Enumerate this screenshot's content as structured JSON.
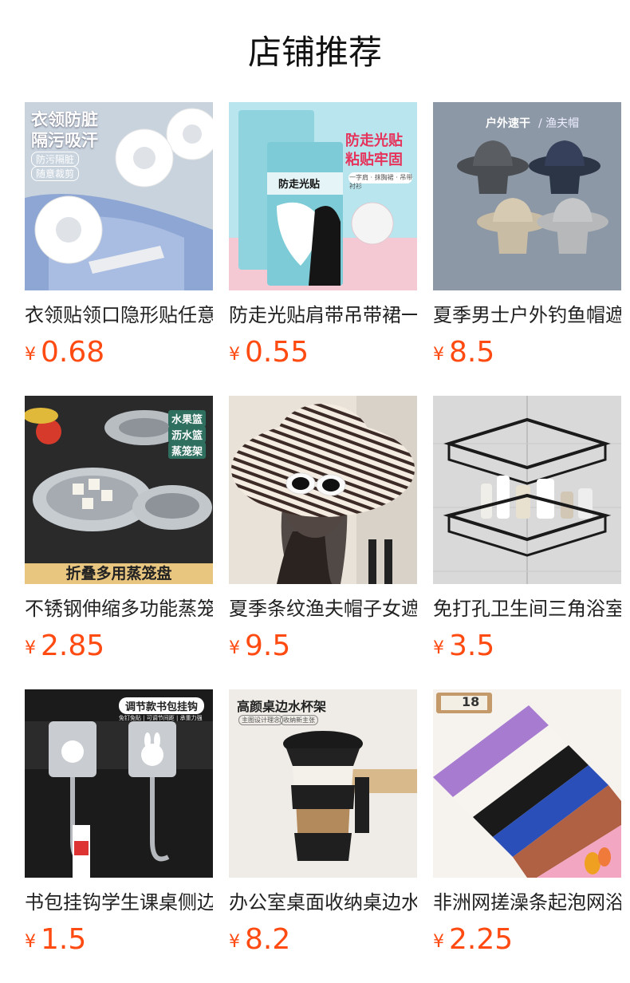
{
  "page": {
    "title": "店铺推荐"
  },
  "currency_symbol": "¥",
  "products": [
    {
      "name": "衣领贴领口隐形贴任意裁剪",
      "price": "0.68",
      "image_text": [
        "衣领防脏",
        "隔污吸汗",
        "防污隔脏",
        "随意裁剪"
      ]
    },
    {
      "name": "防走光贴肩带吊带裙一字肩",
      "price": "0.55",
      "image_text": [
        "防走光贴",
        "粘贴牢固",
        "防走光贴",
        "一字肩 · 抹胸裙 · 吊带衬衫"
      ]
    },
    {
      "name": "夏季男士户外钓鱼帽遮阳渔夫帽",
      "price": "8.5",
      "image_text": [
        "户外速干",
        "/ 渔夫帽"
      ]
    },
    {
      "name": "不锈钢伸缩多功能蒸笼盘",
      "price": "2.85",
      "image_text": [
        "水果篮",
        "沥水篮",
        "蒸笼架",
        "折叠多用蒸笼盘"
      ]
    },
    {
      "name": "夏季条纹渔夫帽子女遮阳帽",
      "price": "9.5",
      "image_text": []
    },
    {
      "name": "免打孔卫生间三角浴室置物架",
      "price": "3.5",
      "image_text": []
    },
    {
      "name": "书包挂钩学生课桌侧边挂钩",
      "price": "1.5",
      "image_text": [
        "调节款书包挂钩",
        "免钉免贴 | 可调节间距 | 承重力强"
      ]
    },
    {
      "name": "办公室桌面收纳桌边水杯架",
      "price": "8.2",
      "image_text": [
        "高颜桌边水杯架",
        "主图设计理念",
        "收纳新主张"
      ]
    },
    {
      "name": "非洲网搓澡条起泡网浴巾",
      "price": "2.25",
      "image_text": [
        "18"
      ]
    }
  ]
}
